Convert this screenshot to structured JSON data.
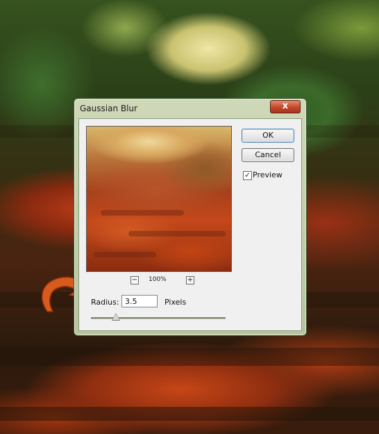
{
  "dialog": {
    "title": "Gaussian Blur",
    "close_label": "x",
    "ok_label": "OK",
    "cancel_label": "Cancel",
    "preview_label": "Preview",
    "preview_checked": true,
    "zoom": {
      "out_label": "−",
      "in_label": "+",
      "level": "100%"
    },
    "radius": {
      "label": "Radius:",
      "value": "3.5",
      "unit": "Pixels",
      "slider_fraction": 0.18
    }
  },
  "annotation": {
    "arrow_color": "#d85a1c"
  }
}
